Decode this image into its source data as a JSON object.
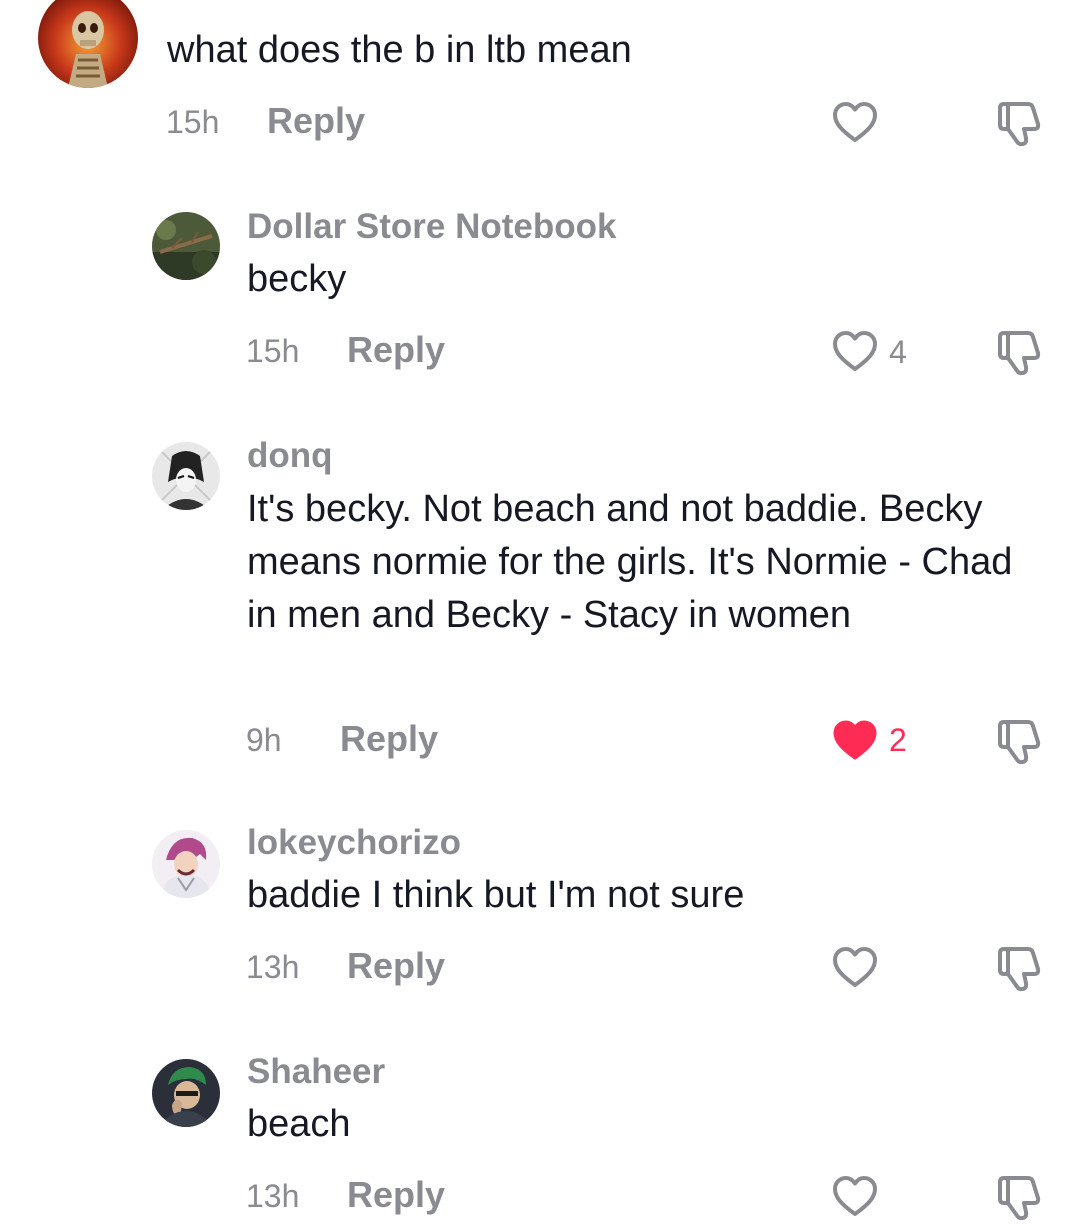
{
  "comments": [
    {
      "username": "",
      "text": "what does the b in ltb mean",
      "time": "15h",
      "reply_label": "Reply",
      "likes": "",
      "liked": false,
      "avatar_icon": "skeleton-avatar"
    },
    {
      "username": "Dollar Store Notebook",
      "text": "becky",
      "time": "15h",
      "reply_label": "Reply",
      "likes": "4",
      "liked": false,
      "avatar_icon": "branch-avatar"
    },
    {
      "username": "donq",
      "text": "It's becky. Not beach and not baddie. Becky means normie for the girls. It's Normie - Chad in men and Becky - Stacy in women",
      "time": "9h",
      "reply_label": "Reply",
      "likes": "2",
      "liked": true,
      "avatar_icon": "manga-avatar"
    },
    {
      "username": "lokeychorizo",
      "text": "baddie I think but I'm not sure",
      "time": "13h",
      "reply_label": "Reply",
      "likes": "",
      "liked": false,
      "avatar_icon": "anime-avatar"
    },
    {
      "username": "Shaheer",
      "text": "beach",
      "time": "13h",
      "reply_label": "Reply",
      "likes": "",
      "liked": false,
      "avatar_icon": "green-hair-avatar"
    }
  ],
  "colors": {
    "text": "#161823",
    "secondary": "#8a8b91",
    "liked": "#fe2c55"
  },
  "icons": {
    "like": "heart-outline-icon",
    "liked": "heart-filled-icon",
    "dislike": "thumbs-down-icon"
  }
}
